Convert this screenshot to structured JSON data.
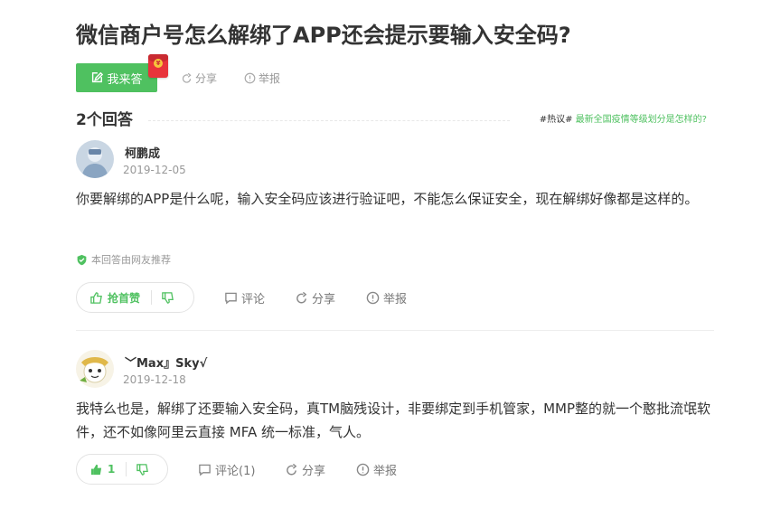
{
  "question": {
    "title": "微信商户号怎么解绑了APP还会提示要输入安全码?",
    "answer_button_label": "我来答",
    "share_label": "分享",
    "report_label": "举报"
  },
  "answers_header": {
    "count_label": "2个回答",
    "hot_tag": "#热议#",
    "hot_topic": "最新全国疫情等级划分是怎样的?"
  },
  "answers": [
    {
      "username": "柯鹏成",
      "date": "2019-12-05",
      "content": "你要解绑的APP是什么呢，输入安全码应该进行验证吧，不能怎么保证安全，现在解绑好像都是这样的。",
      "recommend_note": "本回答由网友推荐",
      "upvote_label": "抢首赞",
      "comment_label": "评论",
      "share_label": "分享",
      "report_label": "举报"
    },
    {
      "username": "﹀Max』Sky√",
      "date": "2019-12-18",
      "content": "我特么也是，解绑了还要输入安全码，真TM脑残设计，非要绑定到手机管家，MMP整的就一个憨批流氓软件，还不如像阿里云直接 MFA 统一标准，气人。",
      "upvote_label": "1",
      "comment_label": "评论(1)",
      "share_label": "分享",
      "report_label": "举报"
    }
  ],
  "colors": {
    "accent": "#4fc160",
    "text": "#333333",
    "muted": "#999999",
    "red_packet": "#e8333b"
  }
}
